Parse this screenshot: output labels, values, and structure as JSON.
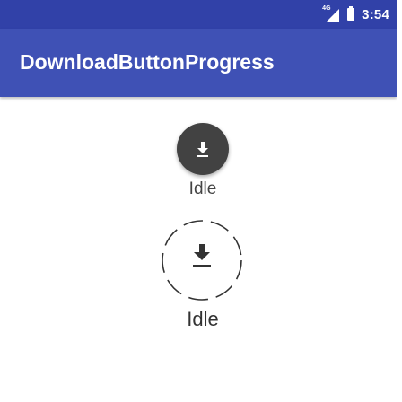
{
  "status_bar": {
    "network": "4G",
    "time": "3:54"
  },
  "app_bar": {
    "title": "DownloadButtonProgress"
  },
  "buttons": [
    {
      "icon": "download-icon",
      "status": "Idle"
    },
    {
      "icon": "download-icon",
      "status": "Idle"
    }
  ],
  "colors": {
    "status_bar": "#3141a8",
    "app_bar": "#3f51b5",
    "fab": "#424242"
  }
}
